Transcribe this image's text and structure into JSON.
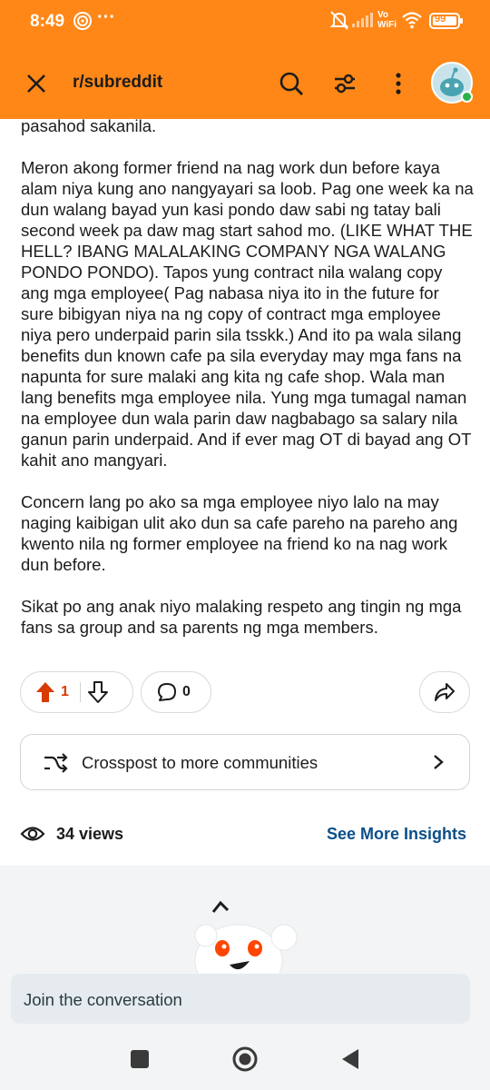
{
  "status_bar": {
    "time": "8:49",
    "battery": "99",
    "network_label": "Vo WiFi"
  },
  "app_bar": {
    "subreddit": "r/subreddit"
  },
  "post": {
    "paragraphs": [
      "pasahod sakanila.",
      "Meron akong former friend na nag work dun before kaya alam niya kung ano nangyayari sa loob. Pag one week ka na dun walang bayad yun kasi pondo daw sabi ng tatay bali second week pa daw mag start sahod mo. (LIKE WHAT THE HELL? IBANG MALALAKING COMPANY NGA WALANG PONDO PONDO). Tapos yung contract nila walang copy ang mga employee( Pag nabasa niya ito in the future for sure bibigyan niya na ng copy of contract mga employee niya pero underpaid parin sila tsskk.) And ito pa wala silang benefits dun known cafe pa sila everyday may mga fans na napunta for sure malaki ang kita ng cafe shop. Wala man lang benefits mga employee nila. Yung mga tumagal naman na employee dun wala parin daw nagbabago sa salary nila ganun parin underpaid. And if ever mag OT di bayad ang OT kahit ano mangyari.",
      "Concern lang po ako sa mga employee niyo lalo na may naging kaibigan ulit ako dun sa cafe pareho na pareho ang kwento nila ng former employee na friend ko na nag work dun before.",
      "Sikat po ang anak niyo malaking respeto ang tingin ng mga fans sa group and sa parents ng mga members."
    ]
  },
  "actions": {
    "upvotes": "1",
    "comments": "0"
  },
  "crosspost": {
    "label": "Crosspost to more communities"
  },
  "insights": {
    "views": "34 views",
    "link": "See More Insights"
  },
  "comment_box": {
    "placeholder": "Join the conversation"
  },
  "colors": {
    "header": "#ff8717",
    "upvote": "#d93a00",
    "link": "#0b4f8a"
  }
}
